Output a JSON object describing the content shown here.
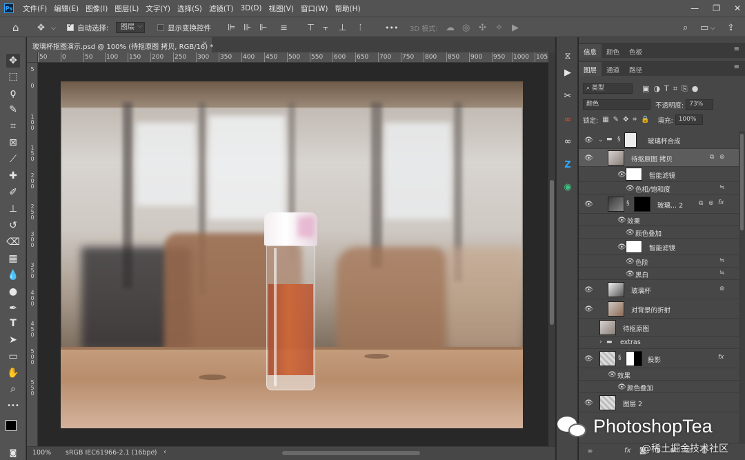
{
  "menubar": {
    "logo": "Ps",
    "items": [
      "文件(F)",
      "编辑(E)",
      "图像(I)",
      "图层(L)",
      "文字(Y)",
      "选择(S)",
      "滤镜(T)",
      "3D(D)",
      "视图(V)",
      "窗口(W)",
      "帮助(H)"
    ]
  },
  "options": {
    "auto_select_label": "自动选择:",
    "auto_select_value": "图层",
    "show_transform_label": "显示变换控件",
    "mode_3d_label": "3D 模式:",
    "more": "•••"
  },
  "document": {
    "tab_title": "玻璃杯抠图演示.psd @ 100% (待抠原图 拷贝, RGB/16) *",
    "close": "×"
  },
  "rulers": {
    "h_ticks": [
      "50",
      "0",
      "50",
      "100",
      "150",
      "200",
      "250",
      "300",
      "350",
      "400",
      "450",
      "500",
      "550",
      "600",
      "650",
      "700",
      "750",
      "800",
      "850",
      "900",
      "950",
      "1000",
      "105"
    ],
    "v_ticks": [
      "5",
      "0",
      "1\n0\n0",
      "1\n5\n0",
      "2\n0\n0",
      "2\n5\n0",
      "3\n0\n0",
      "3\n5\n0",
      "4\n0\n0",
      "4\n5\n0",
      "5\n0\n0",
      "5\n5\n0"
    ]
  },
  "status": {
    "zoom": "100%",
    "profile": "sRGB IEC61966-2.1 (16bpc)"
  },
  "panels": {
    "top_tabs": [
      "信息",
      "颜色",
      "色板"
    ],
    "layer_tabs": [
      "图层",
      "通道",
      "路径"
    ],
    "filter_kind": "类型",
    "blend_mode": "颜色",
    "opacity_label": "不透明度:",
    "opacity_value": "73%",
    "lock_label": "锁定:",
    "fill_label": "填充:",
    "fill_value": "100%"
  },
  "layers": [
    {
      "name": "玻璃杯合成",
      "type": "group"
    },
    {
      "name": "待抠原图 拷贝",
      "type": "smart",
      "selected": true
    },
    {
      "name": "智能滤镜",
      "type": "sub"
    },
    {
      "name": "色相/饱和度",
      "type": "subsub"
    },
    {
      "name": "玻璃... 2",
      "type": "masked"
    },
    {
      "name": "效果",
      "type": "sub"
    },
    {
      "name": "颜色叠加",
      "type": "subsub"
    },
    {
      "name": "智能滤镜",
      "type": "sub"
    },
    {
      "name": "色阶",
      "type": "subsub"
    },
    {
      "name": "黑白",
      "type": "subsub"
    },
    {
      "name": "玻璃杯",
      "type": "smart"
    },
    {
      "name": "对背景的折射",
      "type": "smart"
    },
    {
      "name": "待抠原图",
      "type": "plain"
    },
    {
      "name": "extras",
      "type": "group"
    },
    {
      "name": "投影",
      "type": "masked"
    },
    {
      "name": "效果",
      "type": "sub"
    },
    {
      "name": "颜色叠加",
      "type": "subsub"
    },
    {
      "name": "图层 2",
      "type": "plain"
    }
  ],
  "watermark": {
    "brand": "PhotoshopTea",
    "site": "@稀土掘金技术社区"
  },
  "colors": {
    "accent": "#31a8ff",
    "panel_bg": "#474747",
    "chrome_bg": "#535353",
    "canvas_bg": "#282828"
  }
}
